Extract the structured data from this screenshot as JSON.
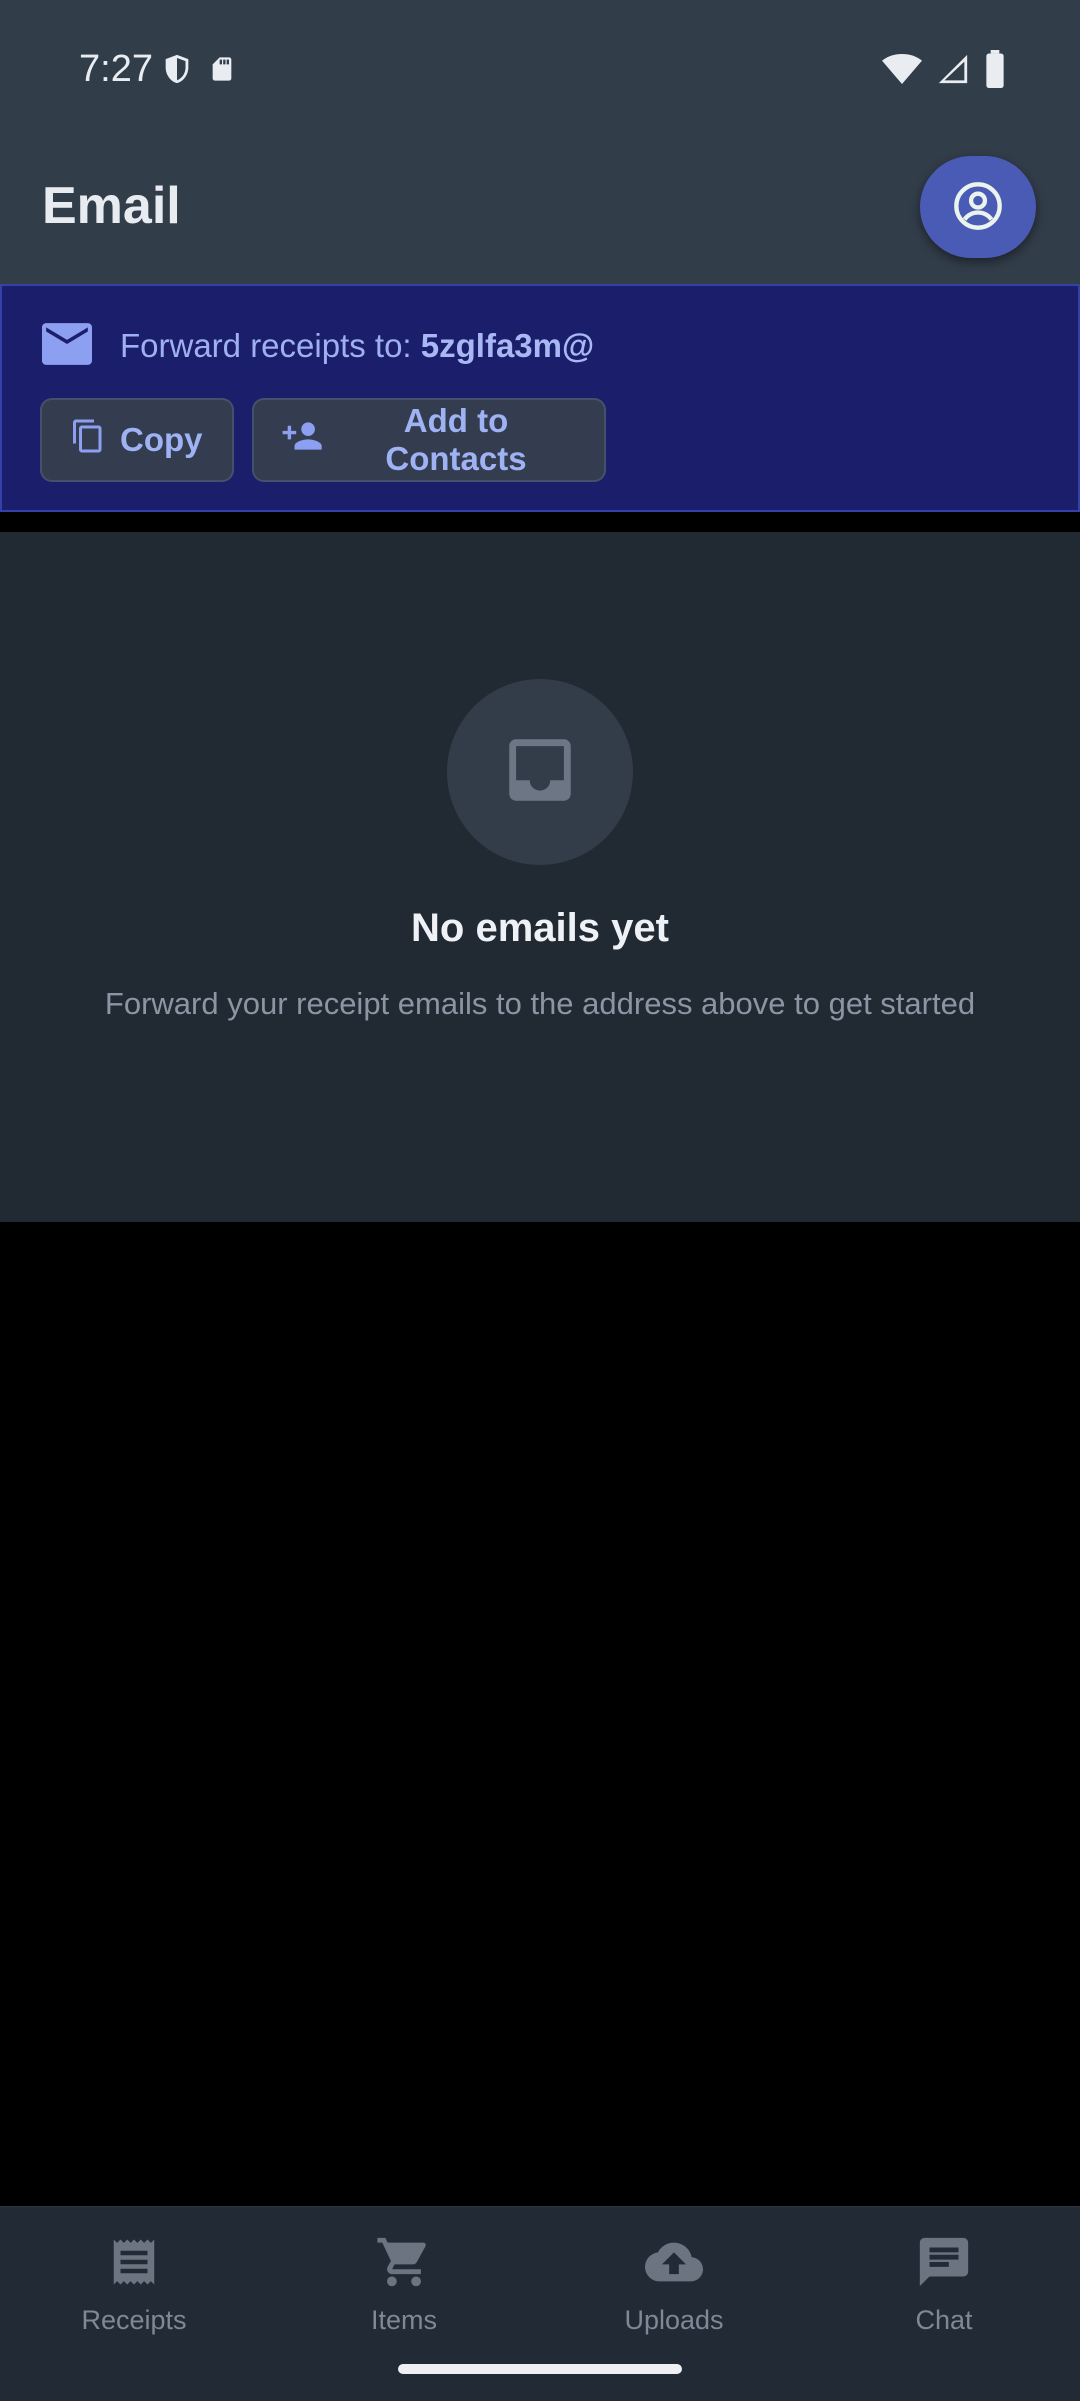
{
  "status_bar": {
    "time": "7:27",
    "left_icons": [
      "shield-icon",
      "sd-card-icon"
    ],
    "right_icons": [
      "wifi-icon",
      "signal-icon",
      "battery-icon"
    ]
  },
  "app_bar": {
    "title": "Email",
    "profile_icon": "account-circle-icon"
  },
  "forward_banner": {
    "icon": "mail-icon",
    "label": "Forward receipts to: ",
    "address": "5zglfa3m@",
    "copy_label": "Copy",
    "add_contacts_label": "Add to Contacts"
  },
  "empty_state": {
    "icon": "inbox-icon",
    "title": "No emails yet",
    "subtitle": "Forward your receipt emails to the address above to get started"
  },
  "bottom_nav": {
    "items": [
      {
        "label": "Receipts",
        "icon": "receipt-icon"
      },
      {
        "label": "Items",
        "icon": "cart-icon"
      },
      {
        "label": "Uploads",
        "icon": "cloud-upload-icon"
      },
      {
        "label": "Chat",
        "icon": "chat-icon"
      }
    ]
  },
  "colors": {
    "app_bar_bg": "#323d4a",
    "banner_bg": "#1b1f6b",
    "accent": "#4a5bb5",
    "panel_bg": "#212933"
  }
}
